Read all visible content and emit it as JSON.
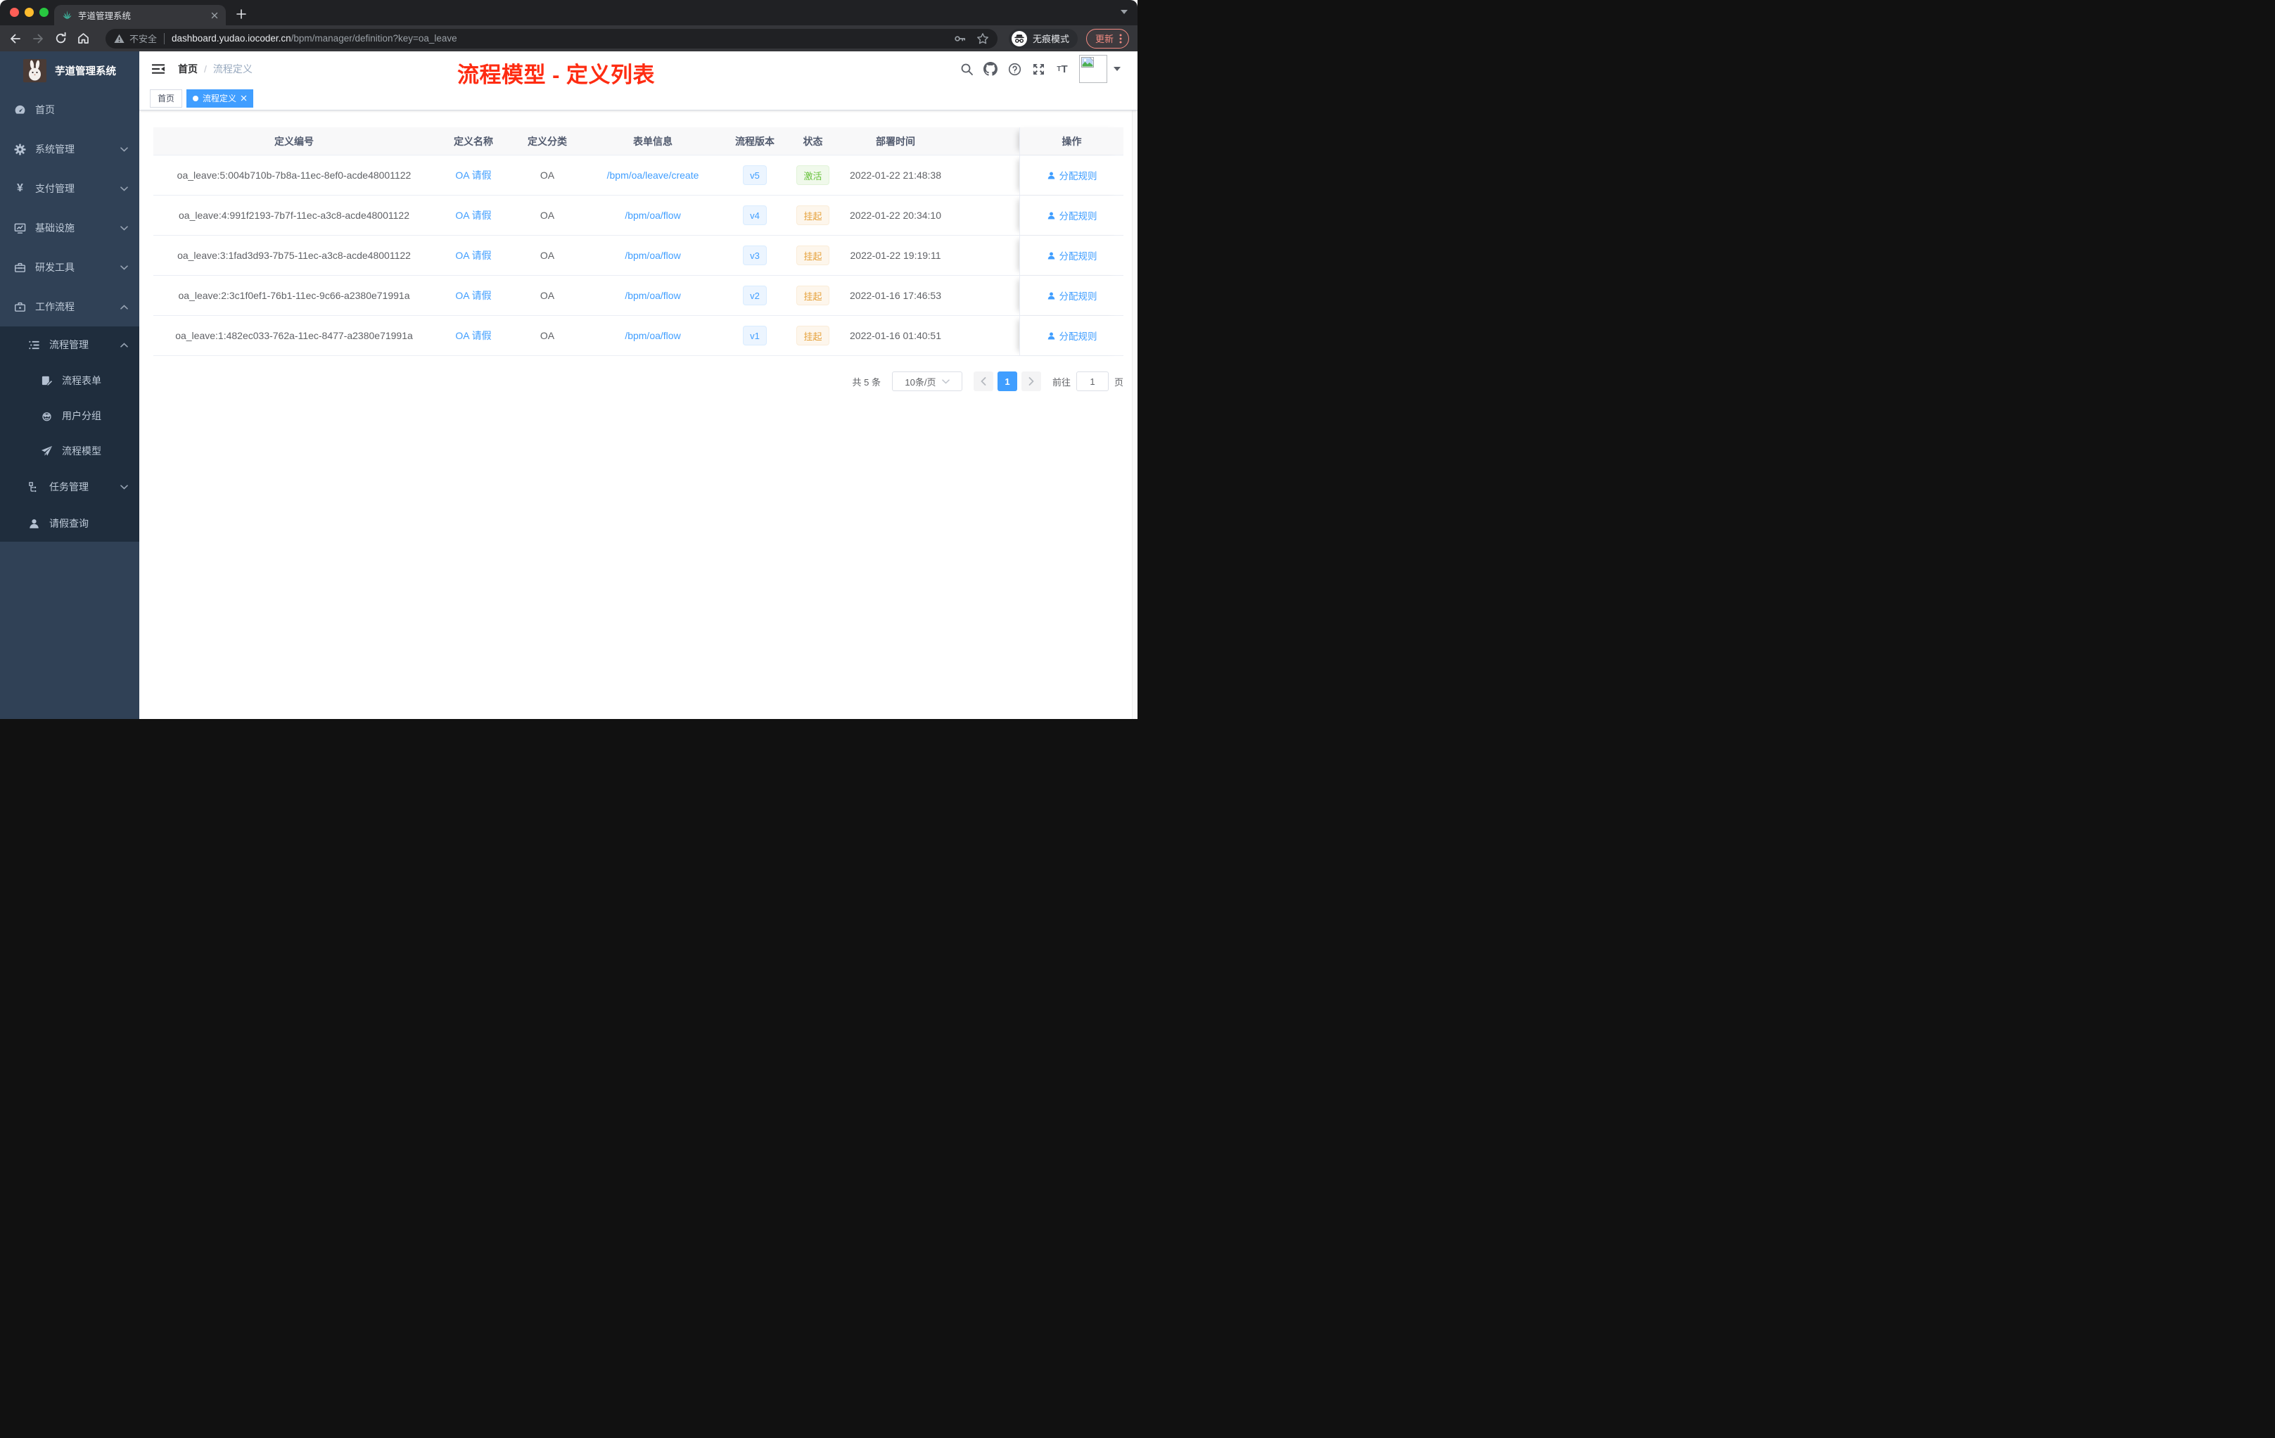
{
  "browser": {
    "tab_title": "芋道管理系统",
    "security_label": "不安全",
    "url_host": "dashboard.yudao.iocoder.cn",
    "url_path": "/bpm/manager/definition?key=oa_leave",
    "incognito_label": "无痕模式",
    "update_label": "更新",
    "icons": [
      "plant-favicon",
      "close",
      "plus",
      "tab-search-caret",
      "back-arrow",
      "forward-arrow",
      "reload",
      "home",
      "warning-triangle",
      "key",
      "star",
      "incognito",
      "kebab-menu"
    ]
  },
  "sidebar": {
    "logo_title": "芋道管理系统",
    "items": [
      {
        "label": "首页",
        "icon": "dashboard-icon",
        "level": 1,
        "chevron": null,
        "in_submenu": false
      },
      {
        "label": "系统管理",
        "icon": "gear-icon",
        "level": 1,
        "chevron": "down",
        "in_submenu": false
      },
      {
        "label": "支付管理",
        "icon": "yen-icon",
        "level": 1,
        "chevron": "down",
        "in_submenu": false
      },
      {
        "label": "基础设施",
        "icon": "monitor-icon",
        "level": 1,
        "chevron": "down",
        "in_submenu": false
      },
      {
        "label": "研发工具",
        "icon": "toolbox-icon",
        "level": 1,
        "chevron": "down",
        "in_submenu": false
      },
      {
        "label": "工作流程",
        "icon": "briefcase-icon",
        "level": 1,
        "chevron": "up",
        "in_submenu": false
      },
      {
        "label": "流程管理",
        "icon": "list-icon",
        "level": 2,
        "chevron": "up",
        "in_submenu": true
      },
      {
        "label": "流程表单",
        "icon": "form-icon",
        "level": 3,
        "chevron": null,
        "in_submenu": true
      },
      {
        "label": "用户分组",
        "icon": "robot-icon",
        "level": 3,
        "chevron": null,
        "in_submenu": true
      },
      {
        "label": "流程模型",
        "icon": "send-icon",
        "level": 3,
        "chevron": null,
        "in_submenu": true
      },
      {
        "label": "任务管理",
        "icon": "tree-icon",
        "level": 2,
        "chevron": "down",
        "in_submenu": true
      },
      {
        "label": "请假查询",
        "icon": "user-icon",
        "level": 2,
        "chevron": null,
        "in_submenu": true
      }
    ]
  },
  "navbar": {
    "breadcrumb": [
      "首页",
      "流程定义"
    ],
    "breadcrumb_separator": "/",
    "annotation": "流程模型 - 定义列表",
    "icons": [
      "search-icon",
      "github-icon",
      "question-icon",
      "fullscreen-icon",
      "font-size-icon",
      "avatar-broken-image",
      "caret-down-icon"
    ]
  },
  "tags": [
    {
      "label": "首页",
      "active": false
    },
    {
      "label": "流程定义",
      "active": true
    }
  ],
  "table": {
    "columns": [
      "定义编号",
      "定义名称",
      "定义分类",
      "表单信息",
      "流程版本",
      "状态",
      "部署时间",
      "操作"
    ],
    "rows": [
      {
        "id": "oa_leave:5:004b710b-7b8a-11ec-8ef0-acde48001122",
        "name": "OA 请假",
        "category": "OA",
        "form": "/bpm/oa/leave/create",
        "version": "v5",
        "status": "激活",
        "status_type": "success",
        "time": "2022-01-22 21:48:38",
        "action": "分配规则"
      },
      {
        "id": "oa_leave:4:991f2193-7b7f-11ec-a3c8-acde48001122",
        "name": "OA 请假",
        "category": "OA",
        "form": "/bpm/oa/flow",
        "version": "v4",
        "status": "挂起",
        "status_type": "warning",
        "time": "2022-01-22 20:34:10",
        "action": "分配规则"
      },
      {
        "id": "oa_leave:3:1fad3d93-7b75-11ec-a3c8-acde48001122",
        "name": "OA 请假",
        "category": "OA",
        "form": "/bpm/oa/flow",
        "version": "v3",
        "status": "挂起",
        "status_type": "warning",
        "time": "2022-01-22 19:19:11",
        "action": "分配规则"
      },
      {
        "id": "oa_leave:2:3c1f0ef1-76b1-11ec-9c66-a2380e71991a",
        "name": "OA 请假",
        "category": "OA",
        "form": "/bpm/oa/flow",
        "version": "v2",
        "status": "挂起",
        "status_type": "warning",
        "time": "2022-01-16 17:46:53",
        "action": "分配规则"
      },
      {
        "id": "oa_leave:1:482ec033-762a-11ec-8477-a2380e71991a",
        "name": "OA 请假",
        "category": "OA",
        "form": "/bpm/oa/flow",
        "version": "v1",
        "status": "挂起",
        "status_type": "warning",
        "time": "2022-01-16 01:40:51",
        "action": "分配规则"
      }
    ]
  },
  "pagination": {
    "total": "共 5 条",
    "page_size": "10条/页",
    "current": "1",
    "goto_label": "前往",
    "goto_value": "1",
    "page_unit": "页"
  },
  "colors": {
    "accent": "#409eff",
    "annotation": "#fe2c12",
    "status_active": "#67c23a",
    "status_suspended": "#e6a23c",
    "sidebar_bg": "#304156",
    "submenu_bg": "#1f2d3d",
    "tag_active_bg": "#409eff"
  }
}
